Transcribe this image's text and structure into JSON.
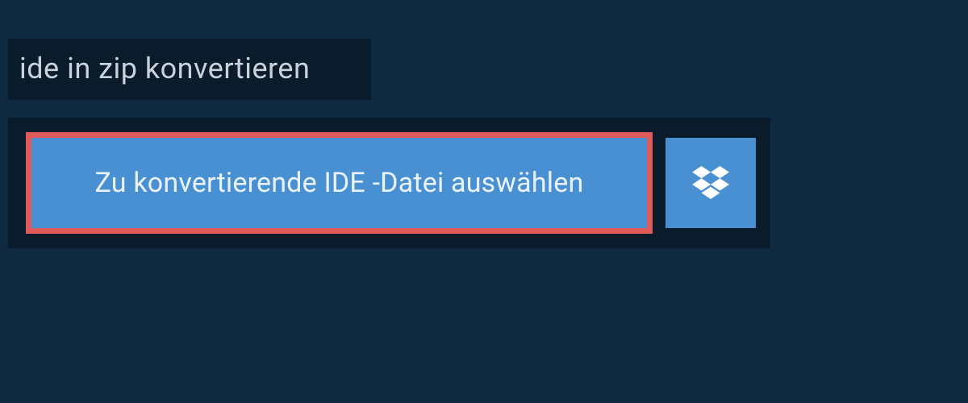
{
  "heading": {
    "title": "ide in zip konvertieren"
  },
  "actions": {
    "select_file_label": "Zu konvertierende IDE -Datei auswählen"
  },
  "colors": {
    "page_bg": "#0f2940",
    "panel_bg": "#0a1b2b",
    "button_bg": "#4990d3",
    "highlight_border": "#e05a5a",
    "text_light": "#eaf3fb",
    "heading_text": "#c8d2db"
  }
}
